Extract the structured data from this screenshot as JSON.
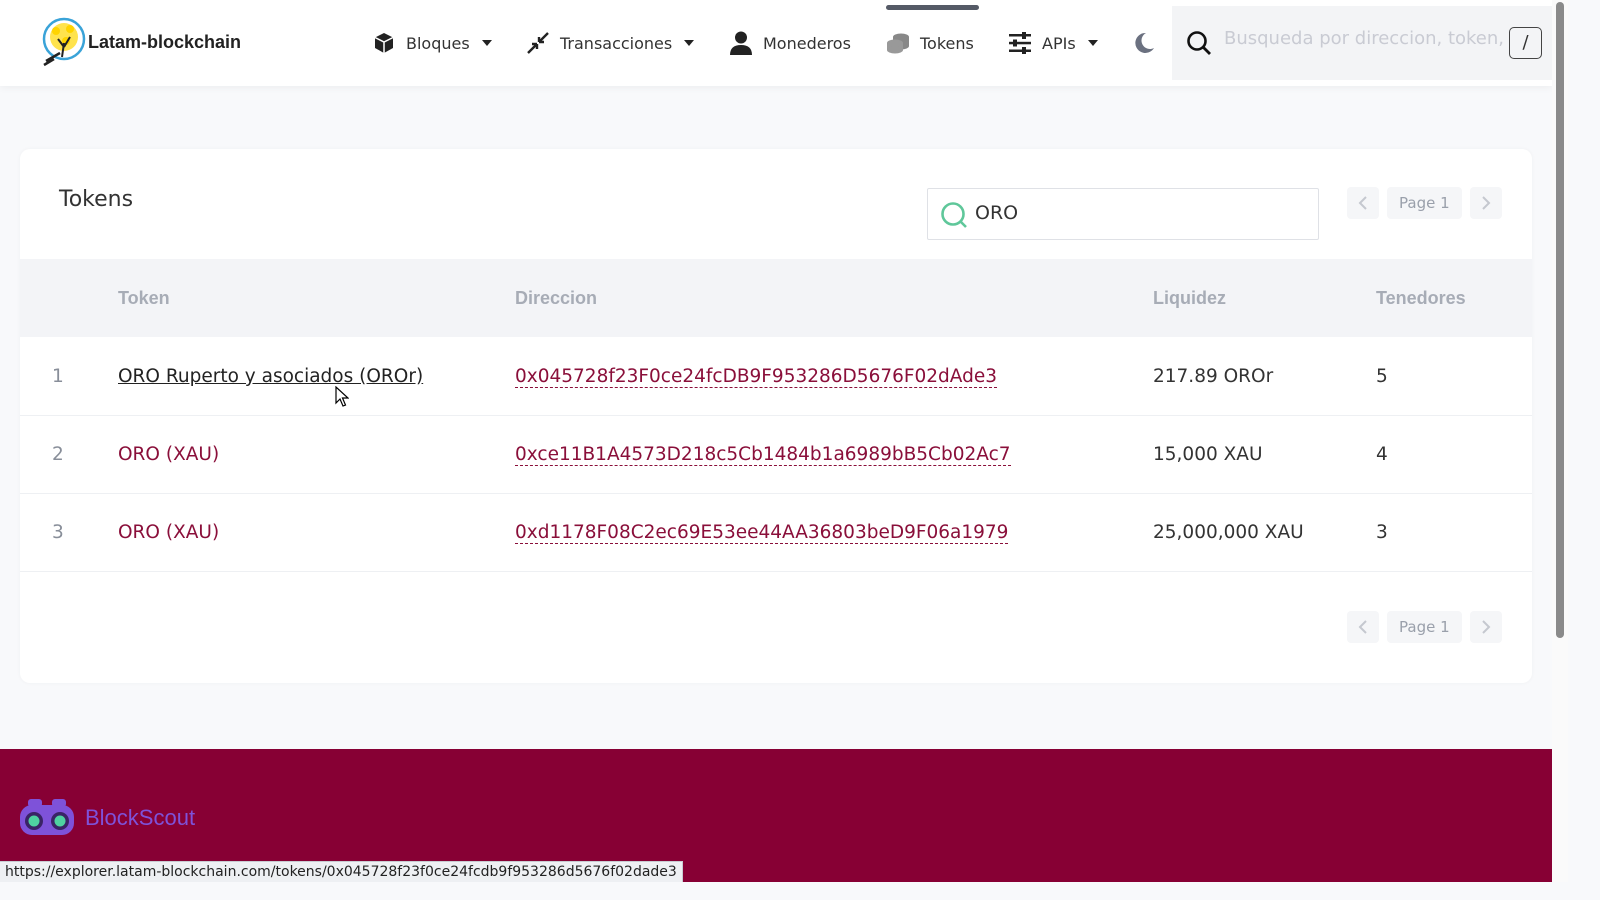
{
  "brand": {
    "name": "Latam-blockchain"
  },
  "nav": {
    "items": [
      {
        "label": "Bloques",
        "icon": "cube-icon",
        "dropdown": true
      },
      {
        "label": "Transacciones",
        "icon": "arrows-exchange-icon",
        "dropdown": true
      },
      {
        "label": "Monederos",
        "icon": "user-icon",
        "dropdown": false
      },
      {
        "label": "Tokens",
        "icon": "coins-icon",
        "dropdown": false,
        "active": true
      },
      {
        "label": "APIs",
        "icon": "sliders-icon",
        "dropdown": true
      }
    ],
    "theme_toggle_icon": "moon-icon"
  },
  "search": {
    "placeholder": "Busqueda por direccion, token, nombre",
    "shortcut": "/"
  },
  "tokens_card": {
    "title": "Tokens",
    "filter_value": "ORO",
    "pagination": {
      "page_label": "Page 1"
    },
    "columns": [
      "Token",
      "Direccion",
      "Liquidez",
      "Tenedores"
    ],
    "rows": [
      {
        "index": "1",
        "token": "ORO Ruperto y asociados (OROr)",
        "address": "0x045728f23F0ce24fcDB9F953286D5676F02dAde3",
        "liquidity": "217.89 OROr",
        "holders": "5"
      },
      {
        "index": "2",
        "token": "ORO (XAU)",
        "address": "0xce11B1A4573D218c5Cb1484b1a6989bB5Cb02Ac7",
        "liquidity": "15,000 XAU",
        "holders": "4"
      },
      {
        "index": "3",
        "token": "ORO (XAU)",
        "address": "0xd1178F08C2ec69E53ee44AA36803beD9F06a1979",
        "liquidity": "25,000,000 XAU",
        "holders": "3"
      }
    ]
  },
  "footer": {
    "name": "BlockScout"
  },
  "status_url": "https://explorer.latam-blockchain.com/tokens/0x045728f23f0ce24fcdb9f953286d5676f02dade3",
  "colors": {
    "accent": "#8a0f3a",
    "footer_bg": "#870034",
    "footer_text": "#7e52d9"
  }
}
